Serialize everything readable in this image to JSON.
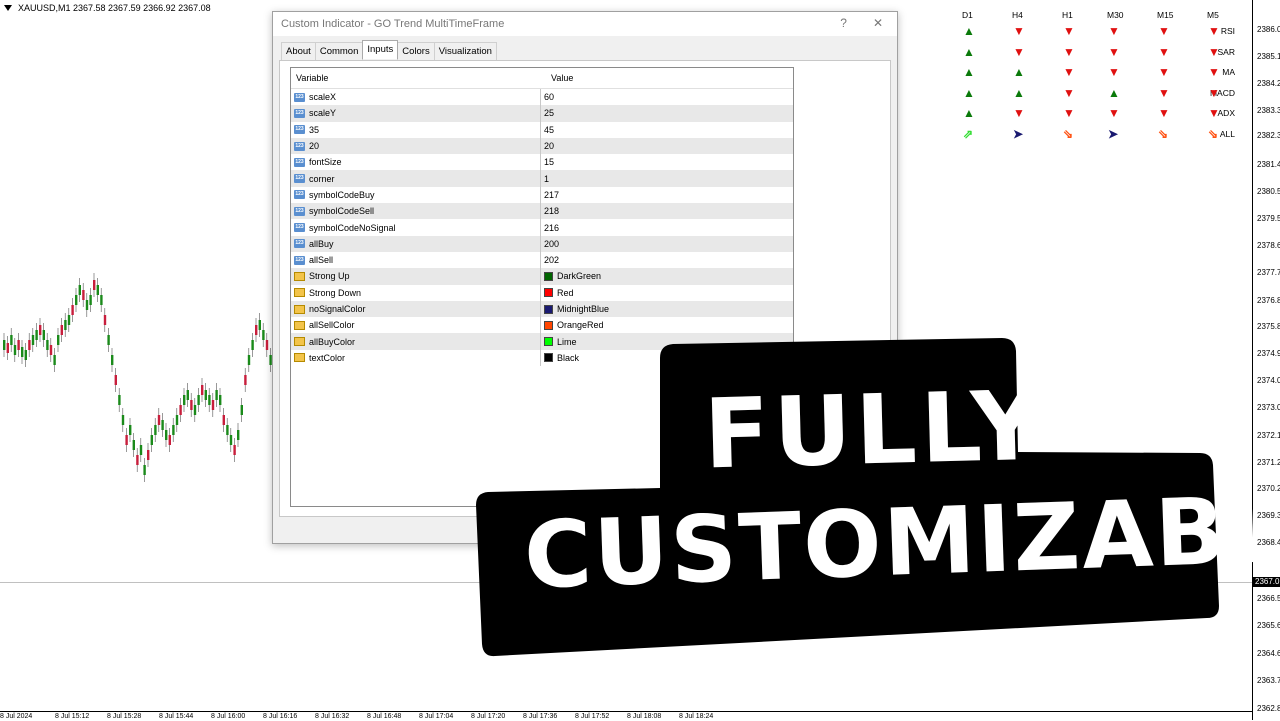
{
  "chart": {
    "symbol_info": "XAUUSD,M1  2367.58 2367.59 2366.92 2367.08",
    "price_labels": [
      "2386.0",
      "2385.1",
      "2384.2",
      "2383.3",
      "2382.3",
      "2381.4",
      "2380.5",
      "2379.5",
      "2378.6",
      "2377.7",
      "2376.8",
      "2375.8",
      "2374.9",
      "2374.0",
      "2373.0",
      "2372.1",
      "2371.2",
      "2370.2",
      "2369.3",
      "2368.4",
      "2366.5",
      "2365.6",
      "2364.6",
      "2363.7",
      "2362.8"
    ],
    "current_price": "2367.0",
    "time_labels": [
      "8 Jul 2024",
      "8 Jul 15:12",
      "8 Jul 15:28",
      "8 Jul 15:44",
      "8 Jul 16:00",
      "8 Jul 16:16",
      "8 Jul 16:32",
      "8 Jul 16:48",
      "8 Jul 17:04",
      "8 Jul 17:20",
      "8 Jul 17:36",
      "8 Jul 17:52",
      "8 Jul 18:08",
      "8 Jul 18:24"
    ]
  },
  "dialog": {
    "title": "Custom Indicator - GO Trend MultiTimeFrame",
    "help_label": "?",
    "close_label": "✕",
    "tabs": [
      "About",
      "Common",
      "Inputs",
      "Colors",
      "Visualization"
    ],
    "active_tab": "Inputs",
    "columns": {
      "variable": "Variable",
      "value": "Value"
    },
    "rows": [
      {
        "icon": "123",
        "name": "scaleX",
        "value": "60"
      },
      {
        "icon": "123",
        "name": "scaleY",
        "value": "25"
      },
      {
        "icon": "123",
        "name": "35",
        "value": "45"
      },
      {
        "icon": "123",
        "name": "20",
        "value": "20"
      },
      {
        "icon": "123",
        "name": "fontSize",
        "value": "15"
      },
      {
        "icon": "123",
        "name": "corner",
        "value": "1"
      },
      {
        "icon": "123",
        "name": "symbolCodeBuy",
        "value": "217"
      },
      {
        "icon": "123",
        "name": "symbolCodeSell",
        "value": "218"
      },
      {
        "icon": "123",
        "name": "symbolCodeNoSignal",
        "value": "216"
      },
      {
        "icon": "123",
        "name": "allBuy",
        "value": "200"
      },
      {
        "icon": "123",
        "name": "allSell",
        "value": "202"
      },
      {
        "icon": "color",
        "name": "Strong Up",
        "value": "DarkGreen",
        "swatch": "#006400"
      },
      {
        "icon": "color",
        "name": "Strong Down",
        "value": "Red",
        "swatch": "#ff0000"
      },
      {
        "icon": "color",
        "name": "noSignalColor",
        "value": "MidnightBlue",
        "swatch": "#191970"
      },
      {
        "icon": "color",
        "name": "allSellColor",
        "value": "OrangeRed",
        "swatch": "#ff4500"
      },
      {
        "icon": "color",
        "name": "allBuyColor",
        "value": "Lime",
        "swatch": "#00ff00"
      },
      {
        "icon": "color",
        "name": "textColor",
        "value": "Black",
        "swatch": "#000000"
      }
    ]
  },
  "signals": {
    "timeframes": [
      "D1",
      "H4",
      "H1",
      "M30",
      "M15",
      "M5"
    ],
    "indicators": [
      "RSI",
      "SAR",
      "MA",
      "MACD",
      "ADX",
      "ALL"
    ],
    "grid": [
      [
        "up",
        "dn",
        "dn",
        "dn",
        "dn",
        "dn"
      ],
      [
        "up",
        "dn",
        "dn",
        "dn",
        "dn",
        "dn"
      ],
      [
        "up",
        "up",
        "dn",
        "dn",
        "dn",
        "dn"
      ],
      [
        "up",
        "up",
        "dn",
        "up",
        "dn",
        "dn"
      ],
      [
        "up",
        "dn",
        "dn",
        "dn",
        "dn",
        "dn"
      ],
      [
        "allbuy",
        "none",
        "allsell",
        "none",
        "allsell",
        "allsell"
      ]
    ]
  },
  "banner": {
    "line1": "FULLY",
    "line2": "CUSTOMIZABLE"
  }
}
